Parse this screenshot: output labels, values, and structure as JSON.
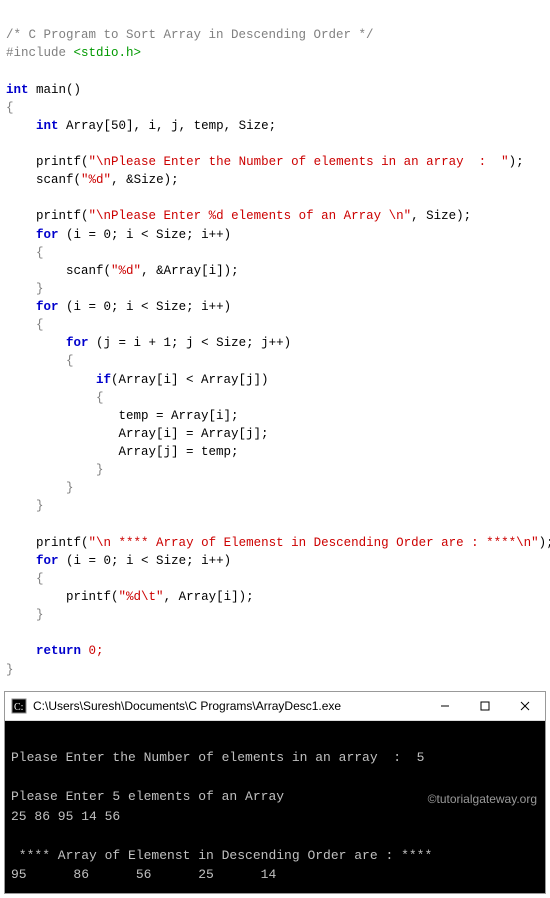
{
  "code": {
    "comment_header": "/* C Program to Sort Array in Descending Order */",
    "include_directive": "#include ",
    "include_file": "<stdio.h>",
    "kw_int": "int",
    "main_name": "main",
    "decl_line": "Array[50], i, j, temp, Size;",
    "printf": "printf",
    "scanf": "scanf",
    "str_prompt1": "\"\\nPlease Enter the Number of elements in an array  :  \"",
    "scan_fmt_d": "\"%d\"",
    "scan_arg_size": "&Size);",
    "str_prompt2": "\"\\nPlease Enter %d elements of an Array \\n\"",
    "prompt2_arg": ", Size);",
    "kw_for": "for",
    "for1": "(i = 0; i < Size; i++)",
    "scan_arg_arr": "&Array[i]);",
    "for_outer": "(i = 0; i < Size; i++)",
    "for_inner": "(j = i + 1; j < Size; j++)",
    "kw_if": "if",
    "if_cond": "(Array[i] < Array[j])",
    "swap1": "temp = Array[i];",
    "swap2": "Array[i] = Array[j];",
    "swap3": "Array[j] = temp;",
    "str_result": "\"\\n **** Array of Elemenst in Descending Order are : ****\\n\"",
    "for_print": "(i = 0; i < Size; i++)",
    "str_tab": "\"%d\\t\"",
    "print_arg": ", Array[i]);",
    "kw_return": "return",
    "return_val": "0;"
  },
  "console": {
    "title": "C:\\Users\\Suresh\\Documents\\C Programs\\ArrayDesc1.exe",
    "line1": "Please Enter the Number of elements in an array  :  5",
    "line2": "Please Enter 5 elements of an Array",
    "line3": "25 86 95 14 56",
    "line4": " **** Array of Elemenst in Descending Order are : ****",
    "line5": "95      86      56      25      14"
  },
  "watermark": "©tutorialgateway.org"
}
